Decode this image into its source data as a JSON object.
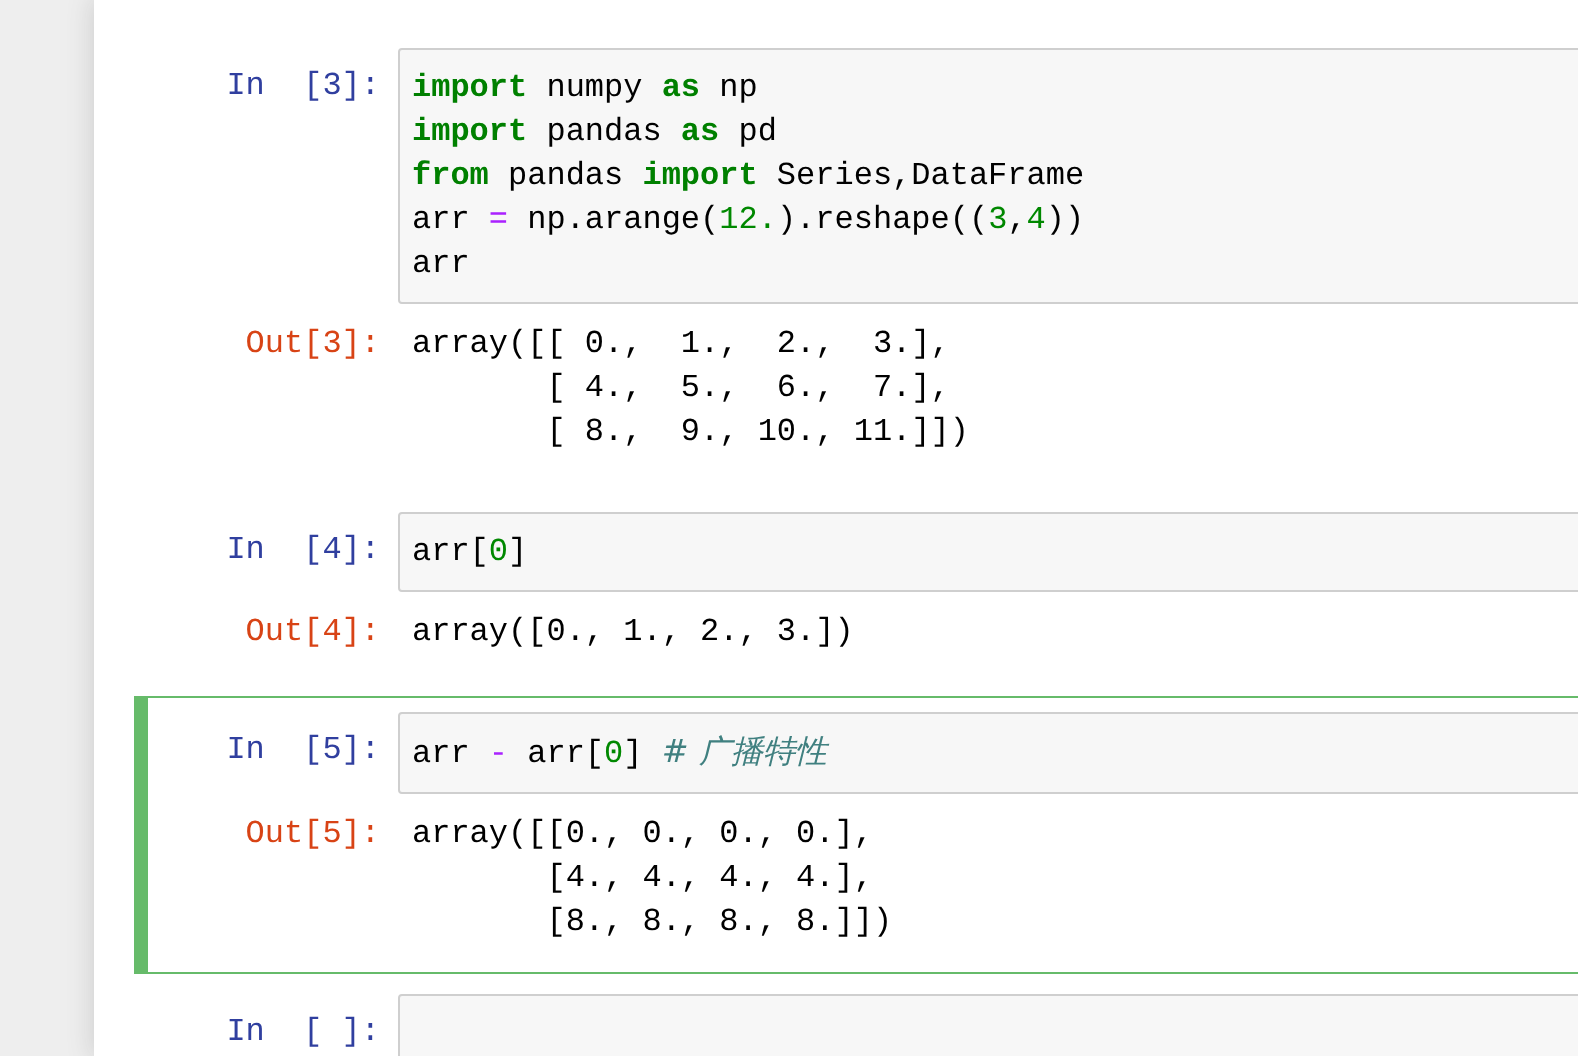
{
  "cells": [
    {
      "selected": false,
      "in_prompt": "In  [3]:",
      "input": [
        [
          {
            "kind": "keyword",
            "text": "import"
          },
          {
            "kind": "plain",
            "text": " numpy "
          },
          {
            "kind": "keyword",
            "text": "as"
          },
          {
            "kind": "plain",
            "text": " np"
          }
        ],
        [
          {
            "kind": "keyword",
            "text": "import"
          },
          {
            "kind": "plain",
            "text": " pandas "
          },
          {
            "kind": "keyword",
            "text": "as"
          },
          {
            "kind": "plain",
            "text": " pd"
          }
        ],
        [
          {
            "kind": "keyword",
            "text": "from"
          },
          {
            "kind": "plain",
            "text": " pandas "
          },
          {
            "kind": "keyword",
            "text": "import"
          },
          {
            "kind": "plain",
            "text": " Series,DataFrame"
          }
        ],
        [
          {
            "kind": "plain",
            "text": "arr "
          },
          {
            "kind": "operator",
            "text": "="
          },
          {
            "kind": "plain",
            "text": " np.arange("
          },
          {
            "kind": "number",
            "text": "12."
          },
          {
            "kind": "plain",
            "text": ").reshape(("
          },
          {
            "kind": "number",
            "text": "3"
          },
          {
            "kind": "plain",
            "text": ","
          },
          {
            "kind": "number",
            "text": "4"
          },
          {
            "kind": "plain",
            "text": "))"
          }
        ],
        [
          {
            "kind": "plain",
            "text": "arr"
          }
        ]
      ],
      "out_prompt": "Out[3]:",
      "output": [
        "array([[ 0.,  1.,  2.,  3.],",
        "       [ 4.,  5.,  6.,  7.],",
        "       [ 8.,  9., 10., 11.]])"
      ]
    },
    {
      "selected": false,
      "in_prompt": "In  [4]:",
      "input": [
        [
          {
            "kind": "plain",
            "text": "arr["
          },
          {
            "kind": "number",
            "text": "0"
          },
          {
            "kind": "plain",
            "text": "]"
          }
        ]
      ],
      "out_prompt": "Out[4]:",
      "output": [
        "array([0., 1., 2., 3.])"
      ]
    },
    {
      "selected": true,
      "in_prompt": "In  [5]:",
      "input": [
        [
          {
            "kind": "plain",
            "text": "arr "
          },
          {
            "kind": "operator",
            "text": "-"
          },
          {
            "kind": "plain",
            "text": " arr["
          },
          {
            "kind": "number",
            "text": "0"
          },
          {
            "kind": "plain",
            "text": "] "
          },
          {
            "kind": "comment",
            "text": "# 广播特性"
          }
        ]
      ],
      "out_prompt": "Out[5]:",
      "output": [
        "array([[0., 0., 0., 0.],",
        "       [4., 4., 4., 4.],",
        "       [8., 8., 8., 8.]])"
      ]
    },
    {
      "selected": false,
      "in_prompt": "In  [ ]:"
    }
  ]
}
